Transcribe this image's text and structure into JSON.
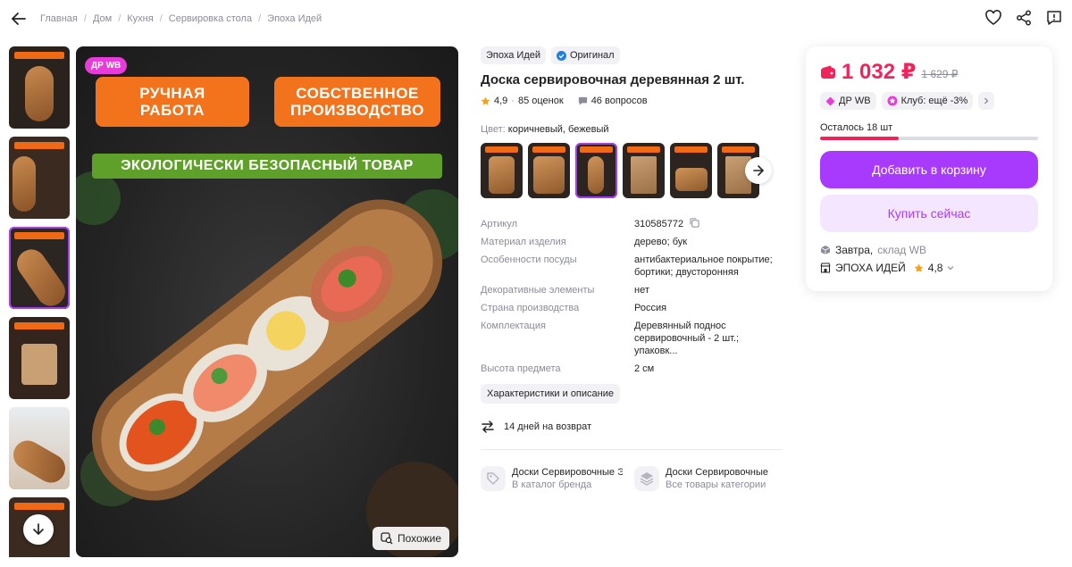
{
  "breadcrumb": [
    "Главная",
    "Дом",
    "Кухня",
    "Сервировка стола",
    "Эпоха Идей"
  ],
  "product": {
    "brand": "Эпоха Идей",
    "original_label": "Оригинал",
    "title": "Доска сервировочная деревянная 2 шт.",
    "rating": "4,9",
    "reviews": "85 оценок",
    "questions": "46 вопросов",
    "color_label": "Цвет:",
    "color_value": "коричневый, бежевый"
  },
  "image": {
    "badge": "ДР WB",
    "promo_left": "РУЧНАЯ\nРАБОТА",
    "promo_right": "СОБСТВЕННОЕ\nПРОИЗВОДСТВО",
    "promo_eco": "ЭКОЛОГИЧЕСКИ БЕЗОПАСНЫЙ ТОВАР",
    "similar_label": "Похожие"
  },
  "specs": [
    {
      "key": "Артикул",
      "value": "310585772"
    },
    {
      "key": "Материал изделия",
      "value": "дерево; бук"
    },
    {
      "key": "Особенности посуды",
      "value": "антибактериальное покрытие; бортики; двусторонняя"
    },
    {
      "key": "Декоративные элементы",
      "value": "нет"
    },
    {
      "key": "Страна производства",
      "value": "Россия"
    },
    {
      "key": "Комплектация",
      "value": "Деревянный поднос сервировочный - 2 шт.; упаковк..."
    },
    {
      "key": "Высота предмета",
      "value": "2 см"
    }
  ],
  "desc_button": "Характеристики и описание",
  "return_text": "14 дней на возврат",
  "brand_links": [
    {
      "title": "Доски Сервировочные Э",
      "sub": "В каталог бренда"
    },
    {
      "title": "Доски Сервировочные",
      "sub": "Все товары категории"
    }
  ],
  "buy": {
    "price": "1 032 ₽",
    "old_price": "1 629 ₽",
    "chip_dr": "ДР WB",
    "chip_club": "Клуб: ещё -3%",
    "stock": "Осталось 18 шт",
    "stock_fill_percent": 36,
    "cart_button": "Добавить в корзину",
    "buy_button": "Купить сейчас",
    "delivery": "Завтра,",
    "delivery_sub": "склад WB",
    "seller": "ЭПОХА ИДЕЙ",
    "seller_rating": "4,8"
  },
  "colors": {
    "accent": "#a73afd",
    "price": "#f0245a",
    "promo_orange": "#f3731c",
    "promo_green": "#5fa02a"
  }
}
